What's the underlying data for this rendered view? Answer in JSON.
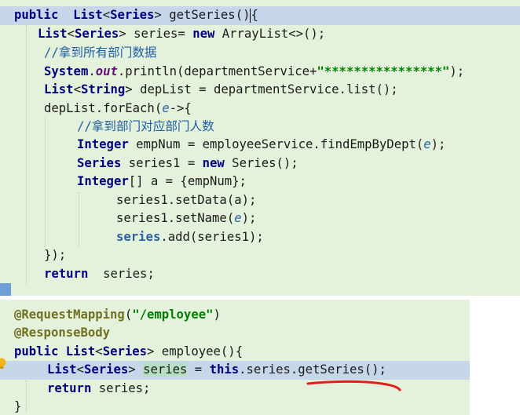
{
  "editor": {
    "top_panel": {
      "lines": [
        {
          "id": "sig",
          "tokens": [
            {
              "c": "kw",
              "t": "public"
            },
            {
              "c": "",
              "t": "  "
            },
            {
              "c": "ty",
              "t": "List"
            },
            {
              "c": "",
              "t": "<"
            },
            {
              "c": "ty",
              "t": "Series"
            },
            {
              "c": "",
              "t": "> getSeries()"
            },
            {
              "c": "",
              "t": "{"
            }
          ]
        },
        {
          "id": "l1",
          "tokens": [
            {
              "c": "ty",
              "t": "List"
            },
            {
              "c": "",
              "t": "<"
            },
            {
              "c": "ty",
              "t": "Series"
            },
            {
              "c": "",
              "t": "> series= "
            },
            {
              "c": "kw",
              "t": "new"
            },
            {
              "c": "",
              "t": " ArrayList<>();"
            }
          ]
        },
        {
          "id": "l2",
          "tokens": [
            {
              "c": "cmt",
              "t": "//拿到所有部门数据"
            }
          ]
        },
        {
          "id": "l3",
          "tokens": [
            {
              "c": "ty",
              "t": "System"
            },
            {
              "c": "",
              "t": "."
            },
            {
              "c": "fld",
              "t": "out"
            },
            {
              "c": "",
              "t": ".println(departmentService+"
            },
            {
              "c": "str",
              "t": "\"****************\""
            },
            {
              "c": "",
              "t": ");"
            }
          ]
        },
        {
          "id": "l4",
          "tokens": [
            {
              "c": "ty",
              "t": "List"
            },
            {
              "c": "",
              "t": "<"
            },
            {
              "c": "ty",
              "t": "String"
            },
            {
              "c": "",
              "t": "> depList = departmentService.list();"
            }
          ]
        },
        {
          "id": "l5",
          "tokens": [
            {
              "c": "",
              "t": "depList.forEach("
            },
            {
              "c": "par",
              "t": "e"
            },
            {
              "c": "",
              "t": "->{"
            }
          ]
        },
        {
          "id": "l6",
          "tokens": [
            {
              "c": "cmt",
              "t": "//拿到部门对应部门人数"
            }
          ]
        },
        {
          "id": "l7",
          "tokens": [
            {
              "c": "ty",
              "t": "Integer"
            },
            {
              "c": "",
              "t": " empNum = employeeService.findEmpByDept("
            },
            {
              "c": "par",
              "t": "e"
            },
            {
              "c": "",
              "t": ");"
            }
          ]
        },
        {
          "id": "l8",
          "tokens": [
            {
              "c": "ty",
              "t": "Series"
            },
            {
              "c": "",
              "t": " series1 = "
            },
            {
              "c": "kw",
              "t": "new"
            },
            {
              "c": "",
              "t": " Series();"
            }
          ]
        },
        {
          "id": "l9",
          "tokens": [
            {
              "c": "ty",
              "t": "Integer"
            },
            {
              "c": "",
              "t": "[] a = {empNum};"
            }
          ]
        },
        {
          "id": "l10",
          "tokens": [
            {
              "c": "",
              "t": "series1.setData(a);"
            }
          ]
        },
        {
          "id": "l11",
          "tokens": [
            {
              "c": "",
              "t": "series1.setName("
            },
            {
              "c": "par",
              "t": "e"
            },
            {
              "c": "",
              "t": ");"
            }
          ]
        },
        {
          "id": "l12",
          "tokens": [
            {
              "c": "ref",
              "t": "series"
            },
            {
              "c": "",
              "t": ".add(series1);"
            }
          ]
        },
        {
          "id": "l13",
          "tokens": [
            {
              "c": "",
              "t": "});"
            }
          ]
        },
        {
          "id": "l14",
          "tokens": [
            {
              "c": "kw",
              "t": "return"
            },
            {
              "c": "",
              "t": "  series;"
            }
          ]
        }
      ]
    },
    "bottom_panel": {
      "lines": [
        {
          "id": "b0",
          "tokens": [
            {
              "c": "ann",
              "t": "@RequestMapping"
            },
            {
              "c": "",
              "t": "("
            },
            {
              "c": "str",
              "t": "\"/employee\""
            },
            {
              "c": "",
              "t": ")"
            }
          ]
        },
        {
          "id": "b1",
          "tokens": [
            {
              "c": "ann",
              "t": "@ResponseBody"
            }
          ]
        },
        {
          "id": "b2",
          "tokens": [
            {
              "c": "kw",
              "t": "public"
            },
            {
              "c": "",
              "t": " "
            },
            {
              "c": "ty",
              "t": "List"
            },
            {
              "c": "",
              "t": "<"
            },
            {
              "c": "ty",
              "t": "Series"
            },
            {
              "c": "",
              "t": "> employee(){"
            }
          ]
        },
        {
          "id": "b3",
          "tokens": [
            {
              "c": "ty",
              "t": "List"
            },
            {
              "c": "",
              "t": "<"
            },
            {
              "c": "ty",
              "t": "Series"
            },
            {
              "c": "",
              "t": "> "
            },
            {
              "c": "usage",
              "t": "series"
            },
            {
              "c": "",
              "t": " = "
            },
            {
              "c": "kw",
              "t": "this"
            },
            {
              "c": "",
              "t": ".series.getSeries();"
            }
          ]
        },
        {
          "id": "b4",
          "tokens": [
            {
              "c": "kw",
              "t": "return"
            },
            {
              "c": "",
              "t": " series;"
            }
          ]
        },
        {
          "id": "b5",
          "tokens": [
            {
              "c": "",
              "t": "}"
            }
          ]
        }
      ]
    },
    "colors": {
      "panel_bg": "#e4f2dc",
      "keyword": "#000080",
      "string": "#008000",
      "comment": "#1e5ea8",
      "line_highlight": "#c7d7ea",
      "annotation_mark": "#e0201c"
    },
    "icons": {
      "gutter_marker": "fold-marker-icon",
      "intention": "light-bulb-icon"
    }
  }
}
